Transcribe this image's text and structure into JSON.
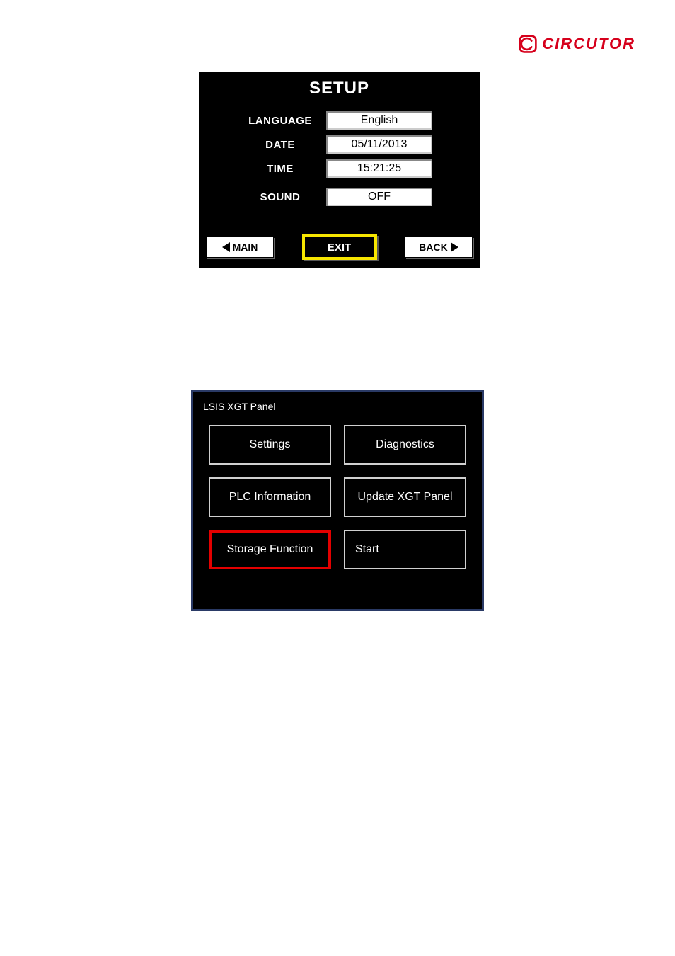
{
  "brand": {
    "name": "CIRCUTOR"
  },
  "setup": {
    "title": "SETUP",
    "rows": {
      "language": {
        "label": "LANGUAGE",
        "value": "English"
      },
      "date": {
        "label": "DATE",
        "value": "05/11/2013"
      },
      "time": {
        "label": "TIME",
        "value": "15:21:25"
      },
      "sound": {
        "label": "SOUND",
        "value": "OFF"
      }
    },
    "buttons": {
      "main": "MAIN",
      "exit": "EXIT",
      "back": "BACK"
    }
  },
  "xgt": {
    "title": "LSIS XGT Panel",
    "buttons": {
      "settings": "Settings",
      "diagnostics": "Diagnostics",
      "plc_info": "PLC Information",
      "update": "Update XGT Panel",
      "storage": "Storage Function",
      "start": "Start"
    }
  }
}
